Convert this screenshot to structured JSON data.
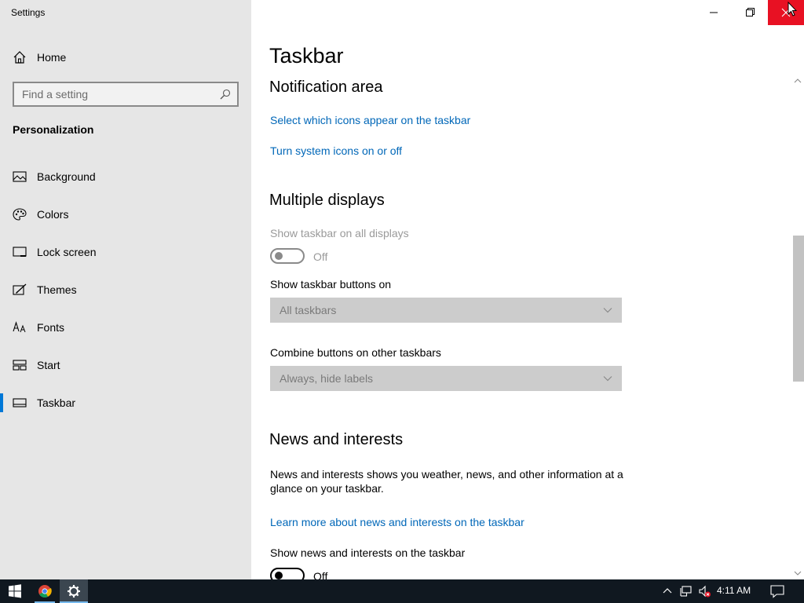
{
  "window": {
    "title": "Settings"
  },
  "sidebar": {
    "home_label": "Home",
    "search_placeholder": "Find a setting",
    "section_title": "Personalization",
    "items": [
      {
        "label": "Background",
        "icon": "image-icon"
      },
      {
        "label": "Colors",
        "icon": "palette-icon"
      },
      {
        "label": "Lock screen",
        "icon": "monitor-icon"
      },
      {
        "label": "Themes",
        "icon": "brush-icon"
      },
      {
        "label": "Fonts",
        "icon": "font-icon"
      },
      {
        "label": "Start",
        "icon": "start-grid-icon"
      },
      {
        "label": "Taskbar",
        "icon": "taskbar-icon",
        "selected": true
      }
    ]
  },
  "main": {
    "page_title": "Taskbar",
    "notification_area": {
      "heading": "Notification area",
      "link1": "Select which icons appear on the taskbar",
      "link2": "Turn system icons on or off"
    },
    "multiple_displays": {
      "heading": "Multiple displays",
      "show_all_label": "Show taskbar on all displays",
      "show_all_state": "Off",
      "buttons_on_label": "Show taskbar buttons on",
      "buttons_on_value": "All taskbars",
      "combine_label": "Combine buttons on other taskbars",
      "combine_value": "Always, hide labels"
    },
    "news": {
      "heading": "News and interests",
      "description": "News and interests shows you weather, news, and other information at a glance on your taskbar.",
      "link": "Learn more about news and interests on the taskbar",
      "toggle_label": "Show news and interests on the taskbar",
      "toggle_state": "Off"
    }
  },
  "taskbar": {
    "clock": "4:11 AM",
    "apps": [
      "Chrome",
      "Settings"
    ]
  },
  "colors": {
    "accent": "#0078d7",
    "link": "#0067b8",
    "close": "#e81123",
    "taskbar": "#101820"
  }
}
